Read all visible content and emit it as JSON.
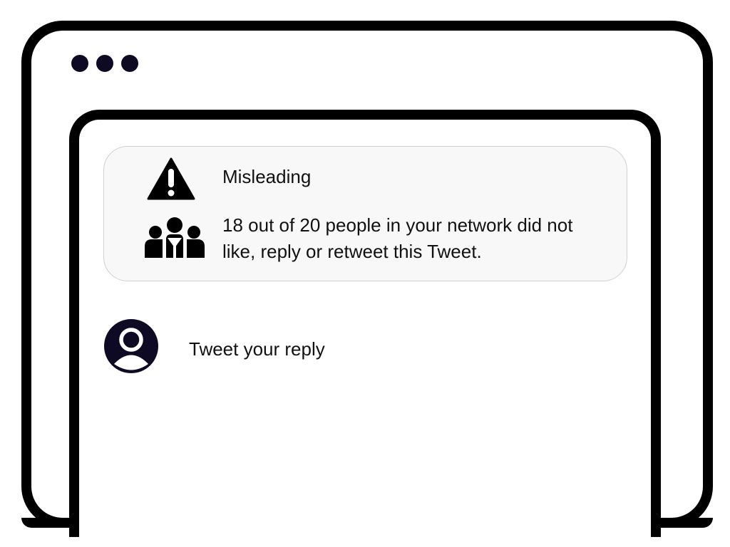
{
  "warning": {
    "label": "Misleading",
    "network_message": "18 out of 20 people in your network did not like, reply or retweet this Tweet.",
    "icon": "warning-triangle-icon",
    "people_icon": "group-icon"
  },
  "reply": {
    "placeholder": "Tweet your reply",
    "avatar_icon": "user-avatar-icon"
  },
  "colors": {
    "dark_navy": "#0f0a24",
    "frame": "#000000",
    "card_bg": "#f8f8f8"
  }
}
